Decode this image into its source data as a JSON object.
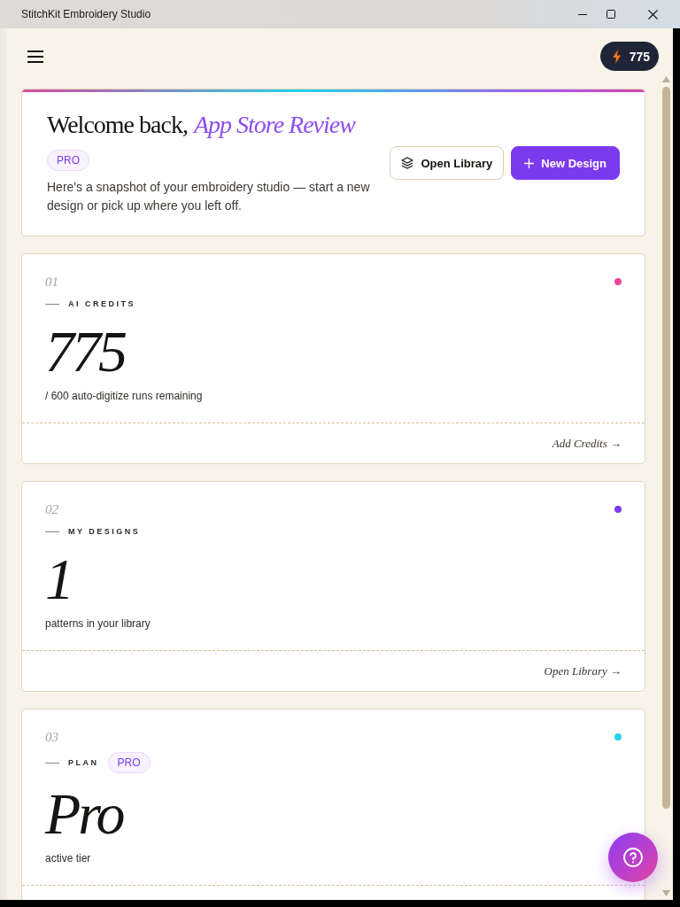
{
  "window": {
    "title": "StitchKit Embroidery Studio"
  },
  "header": {
    "credits": "775"
  },
  "welcome": {
    "greeting": "Welcome back,",
    "name": "App Store Review",
    "badge": "PRO",
    "description": "Here's a snapshot of your embroidery studio — start a new design or pick up where you left off.",
    "buttons": [
      {
        "label": "Open Library",
        "kind": "secondary"
      },
      {
        "label": "New Design",
        "kind": "primary"
      }
    ]
  },
  "stats": [
    {
      "index": "01",
      "label": "AI CREDITS",
      "color": "#ec4899",
      "value": "775",
      "caption": "/ 600 auto-digitize runs remaining",
      "link": "Add Credits →"
    },
    {
      "index": "02",
      "label": "MY DESIGNS",
      "color": "#7c3aed",
      "value": "1",
      "caption": "patterns in your library",
      "link": "Open Library →"
    },
    {
      "index": "03",
      "label": "PLAN",
      "badge": "PRO",
      "color": "#22d3ee",
      "value": "Pro",
      "caption": "active tier"
    }
  ]
}
